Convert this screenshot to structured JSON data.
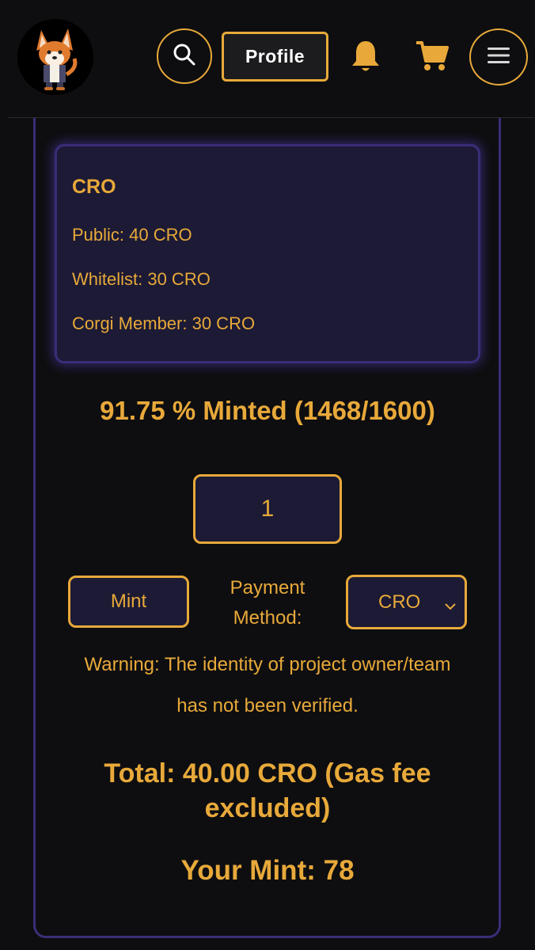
{
  "header": {
    "profile_label": "Profile",
    "icons": {
      "logo": "corgi-mascot-logo",
      "search": "search-icon",
      "bell": "bell-icon",
      "cart": "cart-icon",
      "menu": "hamburger-menu-icon"
    }
  },
  "price_box": {
    "title": "CRO",
    "lines": [
      "Public: 40 CRO",
      "Whitelist: 30 CRO",
      "Corgi Member: 30 CRO"
    ]
  },
  "mint_progress": {
    "text": "91.75 % Minted (1468/1600)"
  },
  "quantity": {
    "value": "1"
  },
  "mint_button_label": "Mint",
  "payment": {
    "label_line1": "Payment",
    "label_line2": "Method:",
    "selected": "CRO"
  },
  "warning": {
    "line1": "Warning: The identity of project owner/team",
    "line2": "has not been verified."
  },
  "total": {
    "line1": "Total: 40.00 CRO (Gas fee",
    "line2": "excluded)"
  },
  "your_mint": "Your Mint: 78",
  "colors": {
    "accent": "#e8a93a",
    "background": "#0e0e10",
    "panel": "#1c1a35",
    "border_purple": "#3a2d78"
  }
}
